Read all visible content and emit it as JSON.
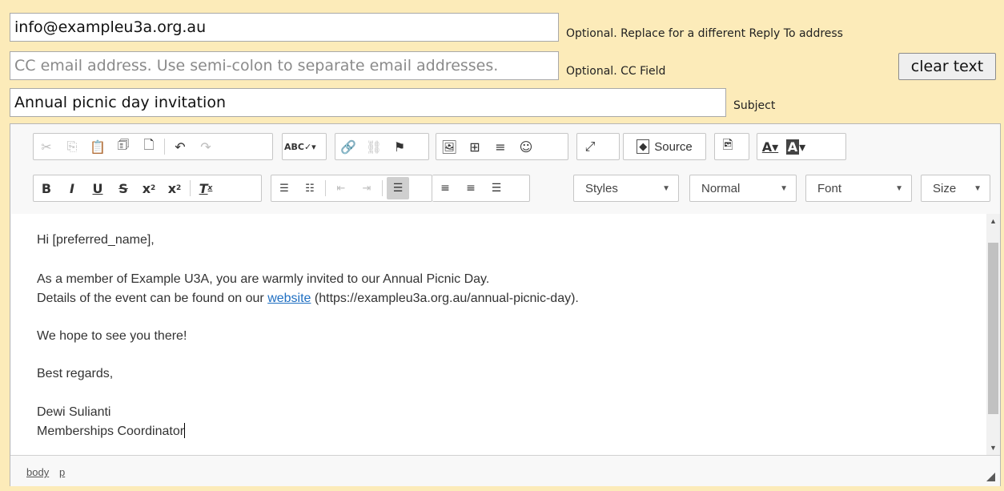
{
  "reply_to": {
    "value": "info@exampleu3a.org.au",
    "hint": "Optional. Replace for a different Reply To address"
  },
  "cc": {
    "placeholder": "CC email address. Use semi-colon to separate email addresses.",
    "hint": "Optional. CC Field",
    "clear_label": "clear text"
  },
  "subject": {
    "value": "Annual picnic day invitation",
    "hint": "Subject"
  },
  "toolbar": {
    "source_label": "Source",
    "styles_label": "Styles",
    "format_label": "Normal",
    "font_label": "Font",
    "size_label": "Size"
  },
  "body": {
    "greeting": "Hi [preferred_name],",
    "line1": "As a member of Example U3A, you are warmly invited to our Annual Picnic Day.",
    "line2_before": "Details of the event can be found on our",
    "link_text": "website",
    "line2_after": "(https://exampleu3a.org.au/annual-picnic-day).",
    "line3": "We hope to see you there!",
    "closing": "Best regards,",
    "sender_name": "Dewi Sulianti",
    "sender_role": "Memberships Coordinator"
  },
  "status": {
    "path": [
      "body",
      "p"
    ]
  }
}
